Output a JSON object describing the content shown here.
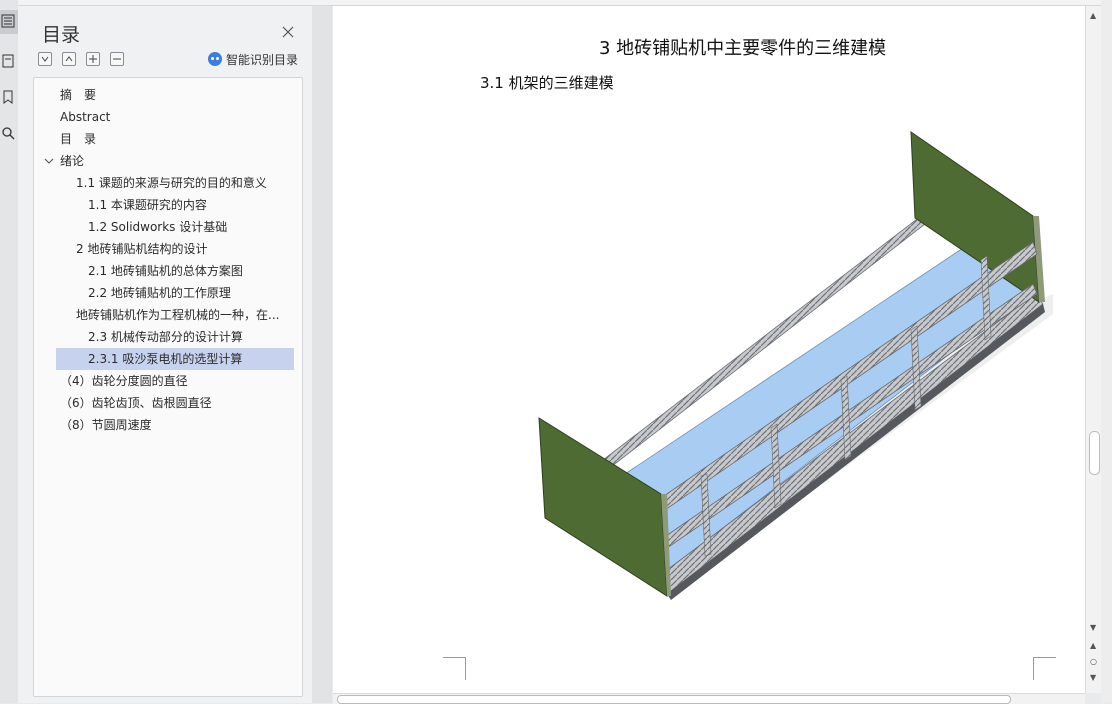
{
  "toc": {
    "title": "目录",
    "ai_toc_label": "智能识别目录",
    "items": [
      {
        "label": "摘　要",
        "level": 0
      },
      {
        "label": "Abstract",
        "level": 0
      },
      {
        "label": "目　录",
        "level": 0
      },
      {
        "label": "绪论",
        "level": 0,
        "expanded": true
      },
      {
        "label": "1.1  课题的来源与研究的目的和意义",
        "level": 1
      },
      {
        "label": "1.1 本课题研究的内容",
        "level": 2
      },
      {
        "label": "1.2 Solidworks 设计基础",
        "level": 2
      },
      {
        "label": "2  地砖铺贴机结构的设计",
        "level": 1
      },
      {
        "label": "2.1  地砖铺贴机的总体方案图",
        "level": 2
      },
      {
        "label": "2.2  地砖铺贴机的工作原理",
        "level": 2
      },
      {
        "label": "地砖铺贴机作为工程机械的一种，在...",
        "level": 1
      },
      {
        "label": "2.3  机械传动部分的设计计算",
        "level": 2
      },
      {
        "label": "2.3.1 吸沙泵电机的选型计算",
        "level": 2,
        "selected": true
      },
      {
        "label": "（4）齿轮分度圆的直径",
        "level": 0
      },
      {
        "label": "（6）齿轮齿顶、齿根圆直径",
        "level": 0
      },
      {
        "label": "（8）节圆周速度",
        "level": 0
      }
    ]
  },
  "document": {
    "chapter_title": "3  地砖铺贴机中主要零件的三维建模",
    "section_title": "3.1 机架的三维建模"
  },
  "colors": {
    "selected_row": "#c7d3ee",
    "panel_green": "#4e6b33",
    "glass_blue": "#a9cdf2",
    "frame_gray": "#8f9298"
  }
}
